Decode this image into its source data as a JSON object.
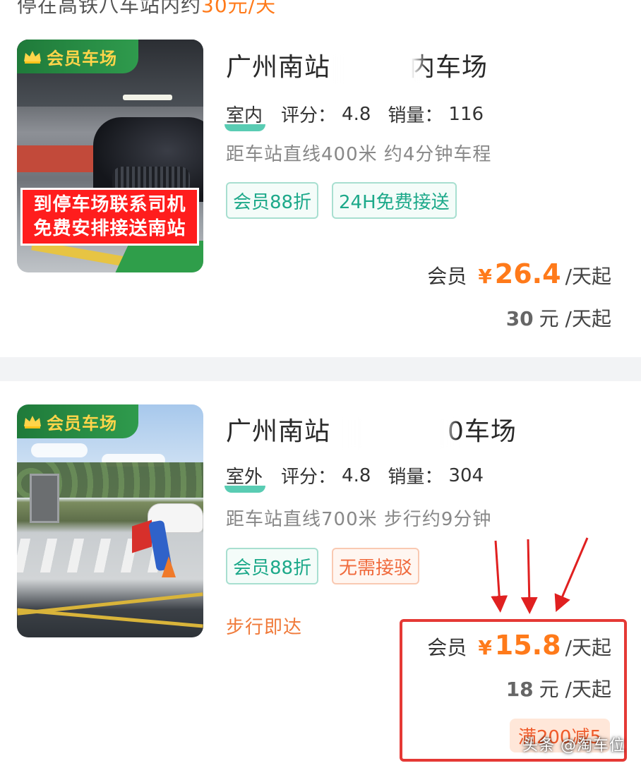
{
  "header": {
    "truncated_prefix": "停在高铁八车站内约",
    "truncated_highlight": "30元/天"
  },
  "lots": [
    {
      "badge": "会员车场",
      "promo_lines": [
        "到停车场联系司机",
        "免费安排接送南站"
      ],
      "title": "广州南站",
      "title_suffix": "内车场",
      "type": "室内",
      "rating_label": "评分：",
      "rating": "4.8",
      "sales_label": "销量：",
      "sales": "116",
      "distance": "距车站直线400米 约4分钟车程",
      "tags": [
        "会员88折",
        "24H免费接送"
      ],
      "member_label": "会员",
      "currency": "¥",
      "member_price": "26.4",
      "per_day": "/天起",
      "regular_price": "30",
      "regular_unit": "元 /天起"
    },
    {
      "badge": "会员车场",
      "title": "广州南站",
      "title_suffix": "0车场",
      "type": "室外",
      "rating_label": "评分：",
      "rating": "4.8",
      "sales_label": "销量：",
      "sales": "304",
      "distance": "距车站直线700米 步行约9分钟",
      "tags": [
        "会员88折",
        "无需接驳"
      ],
      "walk_note": "步行即达",
      "member_label": "会员",
      "currency": "¥",
      "member_price": "15.8",
      "per_day": "/天起",
      "regular_price": "18",
      "regular_unit": "元 /天起",
      "coupon": "满200减5"
    }
  ],
  "watermark": "头条 @淘车位",
  "colors": {
    "accent_orange": "#ff7a1a",
    "badge_green": "#1f7a3a",
    "tag_green": "#1da98a",
    "tag_orange": "#f06a3c",
    "highlight_red": "#e53935"
  },
  "icons": {
    "badge": "crown-icon",
    "annotation": "red-arrow-icon"
  }
}
